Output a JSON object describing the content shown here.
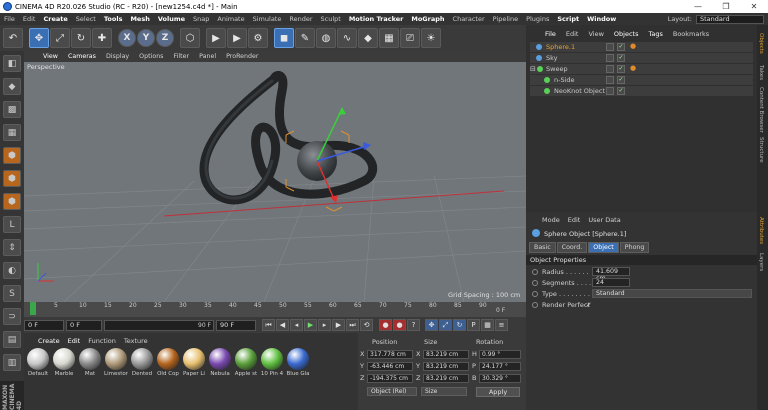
{
  "titlebar": {
    "title": "CINEMA 4D R20.026 Studio (RC - R20) - [new1254.c4d *] - Main",
    "minimize": "—",
    "maximize": "❐",
    "close": "✕"
  },
  "menubar": {
    "items": [
      "File",
      "Edit",
      "Create",
      "Select",
      "Tools",
      "Mesh",
      "Volume",
      "Snap",
      "Animate",
      "Simulate",
      "Render",
      "Sculpt",
      "Motion Tracker",
      "MoGraph",
      "Character",
      "Pipeline",
      "Plugins",
      "Script",
      "Window"
    ],
    "layout_label": "Layout:",
    "layout_value": "Standard"
  },
  "toolbar": {
    "icons": [
      "undo-icon",
      "move-icon",
      "scale-icon",
      "rotate-icon",
      "transform-icon",
      "x-axis-icon",
      "y-axis-icon",
      "z-axis-icon",
      "coordinate-system-icon",
      "render-view-icon",
      "render-picture-viewer-icon",
      "edit-render-settings-icon",
      "cube-icon",
      "pen-icon",
      "subdivision-icon",
      "spline-icon",
      "deformer-icon",
      "floor-icon",
      "camera-icon",
      "light-icon"
    ],
    "x_label": "X",
    "y_label": "Y",
    "z_label": "Z"
  },
  "viewport": {
    "menu": [
      "View",
      "Cameras",
      "Display",
      "Options",
      "Filter",
      "Panel",
      "ProRender"
    ],
    "label": "Perspective",
    "grid_spacing": "Grid Spacing : 100 cm"
  },
  "timeline": {
    "ticks": [
      "0",
      "5",
      "10",
      "15",
      "20",
      "25",
      "30",
      "35",
      "40",
      "45",
      "50",
      "55",
      "60",
      "65",
      "70",
      "75",
      "80",
      "85",
      "90"
    ],
    "current_frame": "0 F"
  },
  "transport": {
    "start": "0 F",
    "current": "0 F",
    "end_slider": "90 F",
    "end": "90 F"
  },
  "materials": {
    "menu": [
      "Create",
      "Edit",
      "Function",
      "Texture"
    ],
    "items": [
      {
        "name": "Default",
        "color": "#c8c8c8"
      },
      {
        "name": "Marble",
        "color": "#d8d8d0"
      },
      {
        "name": "Mat",
        "color": "#8a8a8a"
      },
      {
        "name": "Limestone",
        "color": "#b09a7a"
      },
      {
        "name": "Dented",
        "color": "#9a9a9a"
      },
      {
        "name": "Old Cop",
        "color": "#b5651d"
      },
      {
        "name": "Paper Li",
        "color": "#e8c070"
      },
      {
        "name": "Nebula",
        "color": "#7a4ab0"
      },
      {
        "name": "Apple st",
        "color": "#5aa03a"
      },
      {
        "name": "10 Pin 4",
        "color": "#60c040"
      },
      {
        "name": "Blue Gla",
        "color": "#3a6ad0"
      }
    ]
  },
  "coordinates": {
    "headers": [
      "Position",
      "Size",
      "Rotation"
    ],
    "rows": [
      {
        "axis": "X",
        "pos": "317.778 cm",
        "size_axis": "X",
        "size": "83.219 cm",
        "rot_axis": "H",
        "rot": "0.99 °"
      },
      {
        "axis": "Y",
        "pos": "-63.446 cm",
        "size_axis": "Y",
        "size": "83.219 cm",
        "rot_axis": "P",
        "rot": "24.177 °"
      },
      {
        "axis": "Z",
        "pos": "-194.375 cm",
        "size_axis": "Z",
        "size": "83.219 cm",
        "rot_axis": "B",
        "rot": "30.329 °"
      }
    ],
    "mode": "Object (Rel)",
    "size_mode": "Size",
    "apply": "Apply"
  },
  "brand": "MAXON CINEMA 4D",
  "objects": {
    "menu": [
      "File",
      "Edit",
      "View",
      "Objects",
      "Tags",
      "Bookmarks"
    ],
    "rows": [
      {
        "name": "Sphere.1",
        "color": "#e6a030",
        "icon_color": "#5aa0e0"
      },
      {
        "name": "Sky",
        "color": "#c8c8c8",
        "icon_color": "#5aa0e0"
      },
      {
        "name": "Sweep",
        "color": "#c8c8c8",
        "icon_color": "#5ad05a"
      },
      {
        "name": "n-Side",
        "color": "#c8c8c8",
        "icon_color": "#5ad05a"
      },
      {
        "name": "NeoKnot Object",
        "color": "#c8c8c8",
        "icon_color": "#5ad05a"
      }
    ]
  },
  "sidetabs": [
    "Objects",
    "Takes",
    "Content Browser",
    "Structure",
    "Attributes",
    "Layers"
  ],
  "attributes": {
    "menu": [
      "Mode",
      "Edit",
      "User Data"
    ],
    "title": "Sphere Object [Sphere.1]",
    "tabs": [
      "Basic",
      "Coord.",
      "Object",
      "Phong"
    ],
    "section": "Object Properties",
    "props": [
      {
        "label": "Radius . . . . . .",
        "value": "41.609 cm"
      },
      {
        "label": "Segments . . . .",
        "value": "24"
      },
      {
        "label": "Type . . . . . . . .",
        "value": "Standard"
      },
      {
        "label": "Render Perfect",
        "value": "✓"
      }
    ]
  }
}
